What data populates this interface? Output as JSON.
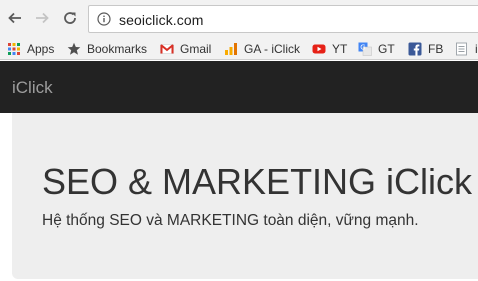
{
  "browser": {
    "url": "seoiclick.com",
    "bookmarks": [
      {
        "label": "Apps",
        "icon": "apps-grid-icon"
      },
      {
        "label": "Bookmarks",
        "icon": "star-icon"
      },
      {
        "label": "Gmail",
        "icon": "gmail-icon"
      },
      {
        "label": "GA - iClick",
        "icon": "analytics-icon"
      },
      {
        "label": "YT",
        "icon": "youtube-icon"
      },
      {
        "label": "GT",
        "icon": "translate-icon"
      },
      {
        "label": "FB",
        "icon": "facebook-icon"
      },
      {
        "label": "i",
        "icon": "page-icon"
      }
    ]
  },
  "site": {
    "brand": "iClick",
    "heading": "SEO & MARKETING iClick",
    "subheading": "Hệ thống SEO và MARKETING toàn diện, vững mạnh."
  },
  "colors": {
    "navbar_bg": "#222222",
    "jumbotron_bg": "#eeeeee",
    "brand_text": "#9d9d9d"
  }
}
